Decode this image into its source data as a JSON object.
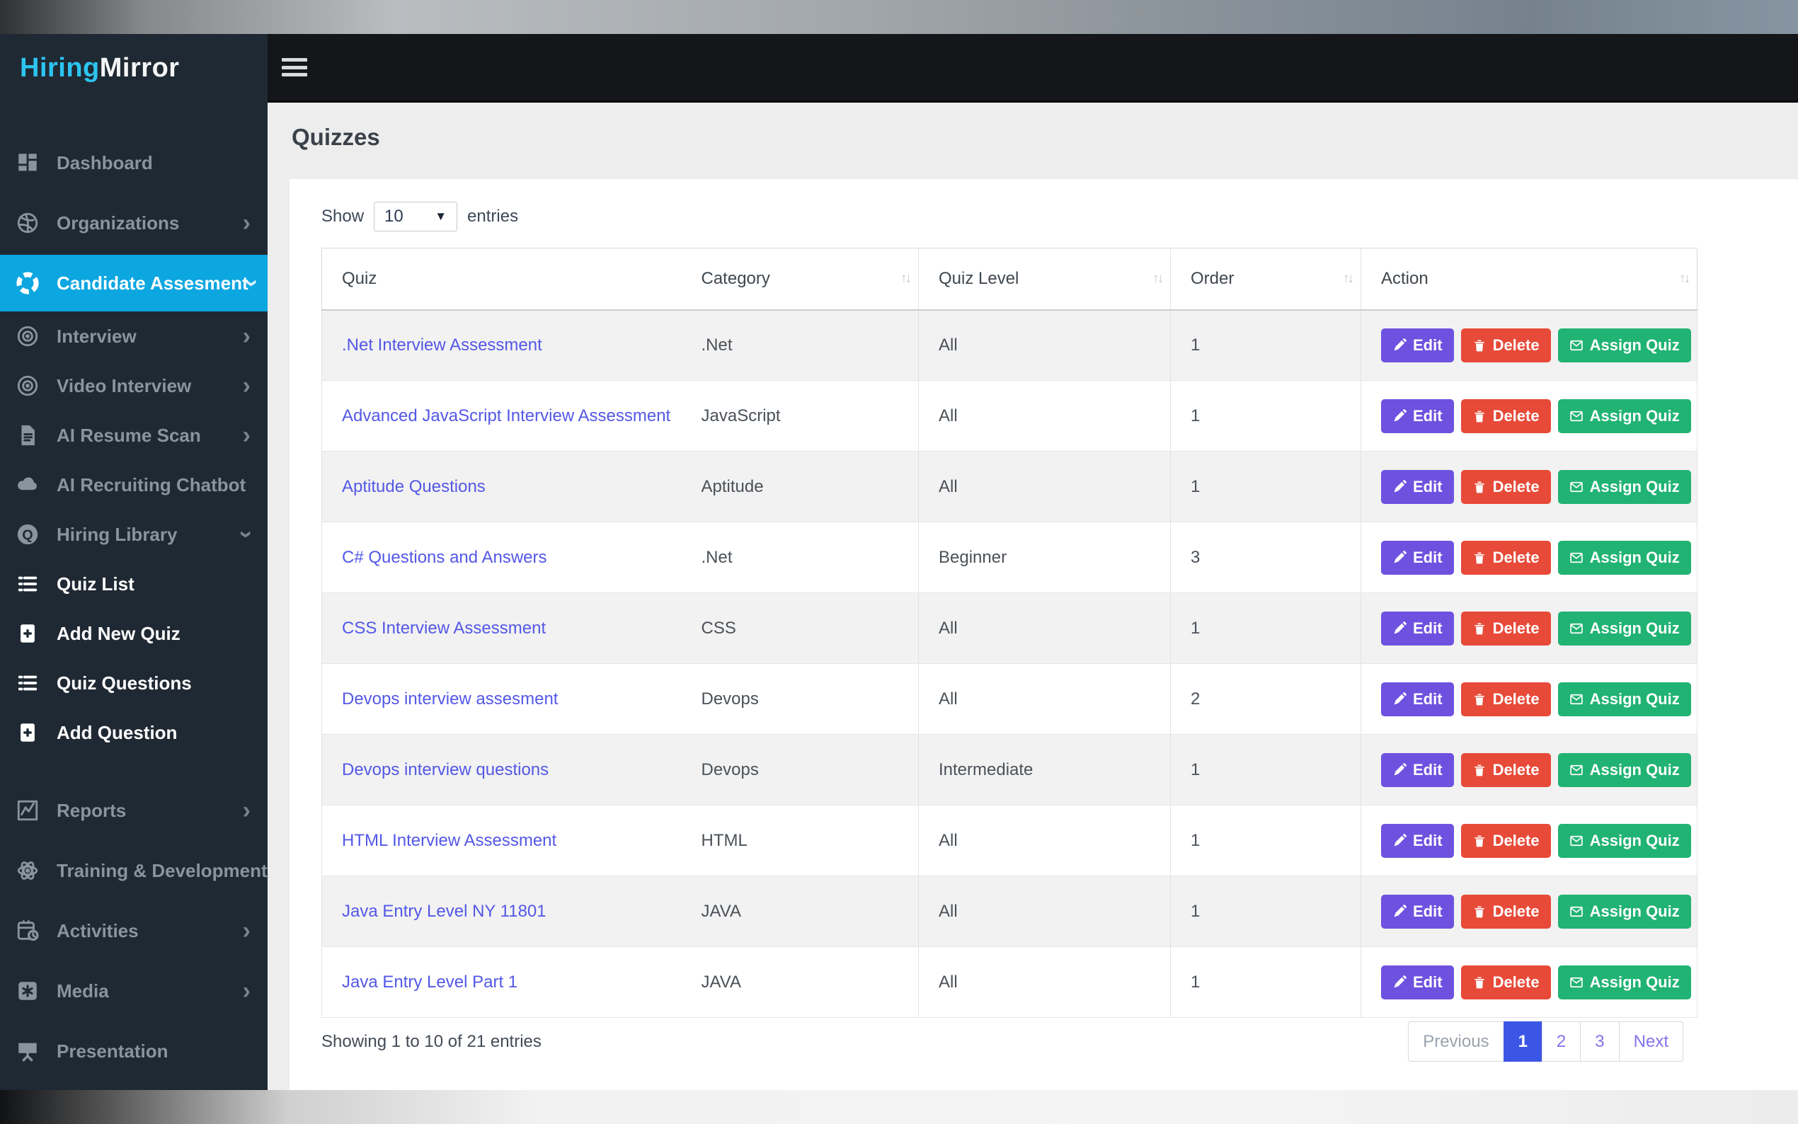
{
  "colors": {
    "sidebar_bg": "#1f2933",
    "sidebar_active_bg": "#0ca6e0",
    "logo_accent": "#2cc4f0",
    "topbar_bg": "#141619",
    "content_bg": "#ededed",
    "link": "#5358e6",
    "btn_edit": "#6e52df",
    "btn_delete": "#e74a38",
    "btn_assign": "#21b373",
    "pagination_active": "#3b56e4",
    "row_stripe": "#f2f2f2"
  },
  "sidebar": {
    "logo": {
      "part1": "Hiring",
      "part2": "Mirror"
    },
    "items": [
      {
        "label": "Dashboard",
        "icon": "dashboard-icon",
        "chevron": "none",
        "gap_after": true
      },
      {
        "label": "Organizations",
        "icon": "organizations-icon",
        "chevron": "right"
      },
      {
        "label": "Candidate Assesment",
        "icon": "candidate-assessment-icon",
        "chevron": "down",
        "active": true
      },
      {
        "label": "Interview",
        "icon": "interview-icon",
        "chevron": "right"
      },
      {
        "label": "Video Interview",
        "icon": "video-interview-icon",
        "chevron": "right"
      },
      {
        "label": "AI Resume Scan",
        "icon": "resume-scan-icon",
        "chevron": "right"
      },
      {
        "label": "AI Recruiting Chatbot",
        "icon": "chatbot-icon",
        "chevron": "none"
      },
      {
        "label": "Hiring Library",
        "icon": "hiring-library-icon",
        "chevron": "down"
      },
      {
        "label": "Quiz List",
        "icon": "quiz-list-icon",
        "chevron": "none",
        "bright": true
      },
      {
        "label": "Add New Quiz",
        "icon": "add-new-quiz-icon",
        "chevron": "none",
        "bright": true
      },
      {
        "label": "Quiz Questions",
        "icon": "quiz-questions-icon",
        "chevron": "none",
        "bright": true
      },
      {
        "label": "Add Question",
        "icon": "add-question-icon",
        "chevron": "none",
        "bright": true
      },
      {
        "label": "Reports",
        "icon": "reports-icon",
        "chevron": "right",
        "gap_before": true,
        "spaced": true
      },
      {
        "label": "Training & Development",
        "icon": "training-icon",
        "chevron": "right",
        "spaced": true
      },
      {
        "label": "Activities",
        "icon": "activities-icon",
        "chevron": "right",
        "spaced": true
      },
      {
        "label": "Media",
        "icon": "media-icon",
        "chevron": "right",
        "spaced": true
      },
      {
        "label": "Presentation",
        "icon": "presentation-icon",
        "chevron": "none",
        "spaced": true
      }
    ]
  },
  "topbar": {
    "menu_icon": "hamburger-icon"
  },
  "page": {
    "title": "Quizzes"
  },
  "table_controls": {
    "show_label": "Show",
    "page_size": "10",
    "entries_label": "entries",
    "caret_icon": "caret-down-icon"
  },
  "table": {
    "columns": [
      {
        "label": "Quiz",
        "sortable": false
      },
      {
        "label": "Category",
        "sortable": true
      },
      {
        "label": "Quiz Level",
        "sortable": true
      },
      {
        "label": "Order",
        "sortable": true
      },
      {
        "label": "Action",
        "sortable": true
      }
    ],
    "rows": [
      {
        "quiz": ".Net Interview Assessment",
        "category": ".Net",
        "level": "All",
        "order": "1"
      },
      {
        "quiz": "Advanced JavaScript Interview Assessment",
        "category": "JavaScript",
        "level": "All",
        "order": "1"
      },
      {
        "quiz": "Aptitude Questions",
        "category": "Aptitude",
        "level": "All",
        "order": "1"
      },
      {
        "quiz": "C# Questions and Answers",
        "category": ".Net",
        "level": "Beginner",
        "order": "3"
      },
      {
        "quiz": "CSS Interview Assessment",
        "category": "CSS",
        "level": "All",
        "order": "1"
      },
      {
        "quiz": "Devops interview assesment",
        "category": "Devops",
        "level": "All",
        "order": "2"
      },
      {
        "quiz": "Devops interview questions",
        "category": "Devops",
        "level": "Intermediate",
        "order": "1"
      },
      {
        "quiz": "HTML Interview Assessment",
        "category": "HTML",
        "level": "All",
        "order": "1"
      },
      {
        "quiz": "Java Entry Level NY 11801",
        "category": "JAVA",
        "level": "All",
        "order": "1"
      },
      {
        "quiz": "Java Entry Level Part 1",
        "category": "JAVA",
        "level": "All",
        "order": "1"
      }
    ],
    "actions": {
      "edit": {
        "label": "Edit",
        "icon": "pencil-icon"
      },
      "delete": {
        "label": "Delete",
        "icon": "trash-icon"
      },
      "assign": {
        "label": "Assign Quiz",
        "icon": "envelope-icon"
      }
    }
  },
  "footer": {
    "summary": "Showing 1 to 10 of 21 entries",
    "pagination": [
      {
        "label": "Previous",
        "active": false
      },
      {
        "label": "1",
        "active": true
      },
      {
        "label": "2",
        "active": false
      },
      {
        "label": "3",
        "active": false
      },
      {
        "label": "Next",
        "active": false
      }
    ]
  }
}
